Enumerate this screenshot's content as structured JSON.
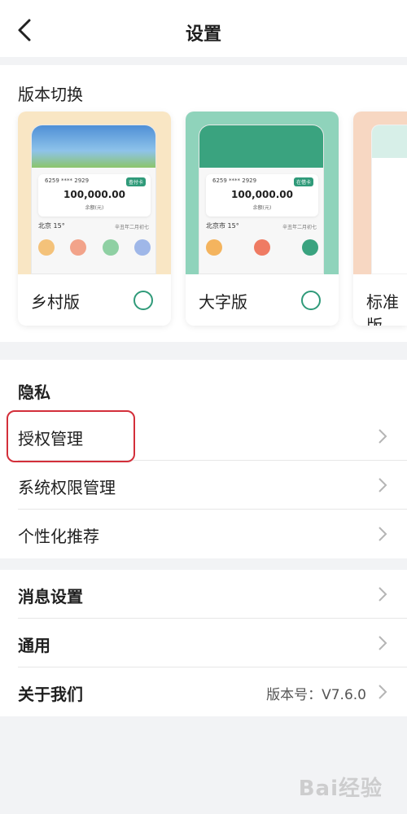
{
  "header": {
    "title": "设置"
  },
  "versions": {
    "title": "版本切换",
    "cards": [
      {
        "label": "乡村版",
        "account": "6259 **** 2929",
        "amount": "100,000.00",
        "balance": "余额(元)",
        "weather": "北京 15°",
        "date": "辛丑年二月初七",
        "tag": "查付卡"
      },
      {
        "label": "大字版",
        "account": "6259 **** 2929",
        "amount": "100,000.00",
        "balance": "余额(元)",
        "weather": "北京市 15°",
        "date": "辛丑年二月初七",
        "tag": "在借卡"
      },
      {
        "label": "标准版"
      }
    ]
  },
  "privacy": {
    "title": "隐私",
    "items": [
      {
        "label": "授权管理"
      },
      {
        "label": "系统权限管理"
      },
      {
        "label": "个性化推荐"
      }
    ]
  },
  "misc": {
    "items": [
      {
        "label": "消息设置"
      },
      {
        "label": "通用"
      },
      {
        "label": "关于我们",
        "value": "版本号：V7.6.0"
      }
    ]
  },
  "watermark": "Bai经验",
  "colors": {
    "accent": "#2f9a79",
    "highlight": "#d32f3a"
  }
}
